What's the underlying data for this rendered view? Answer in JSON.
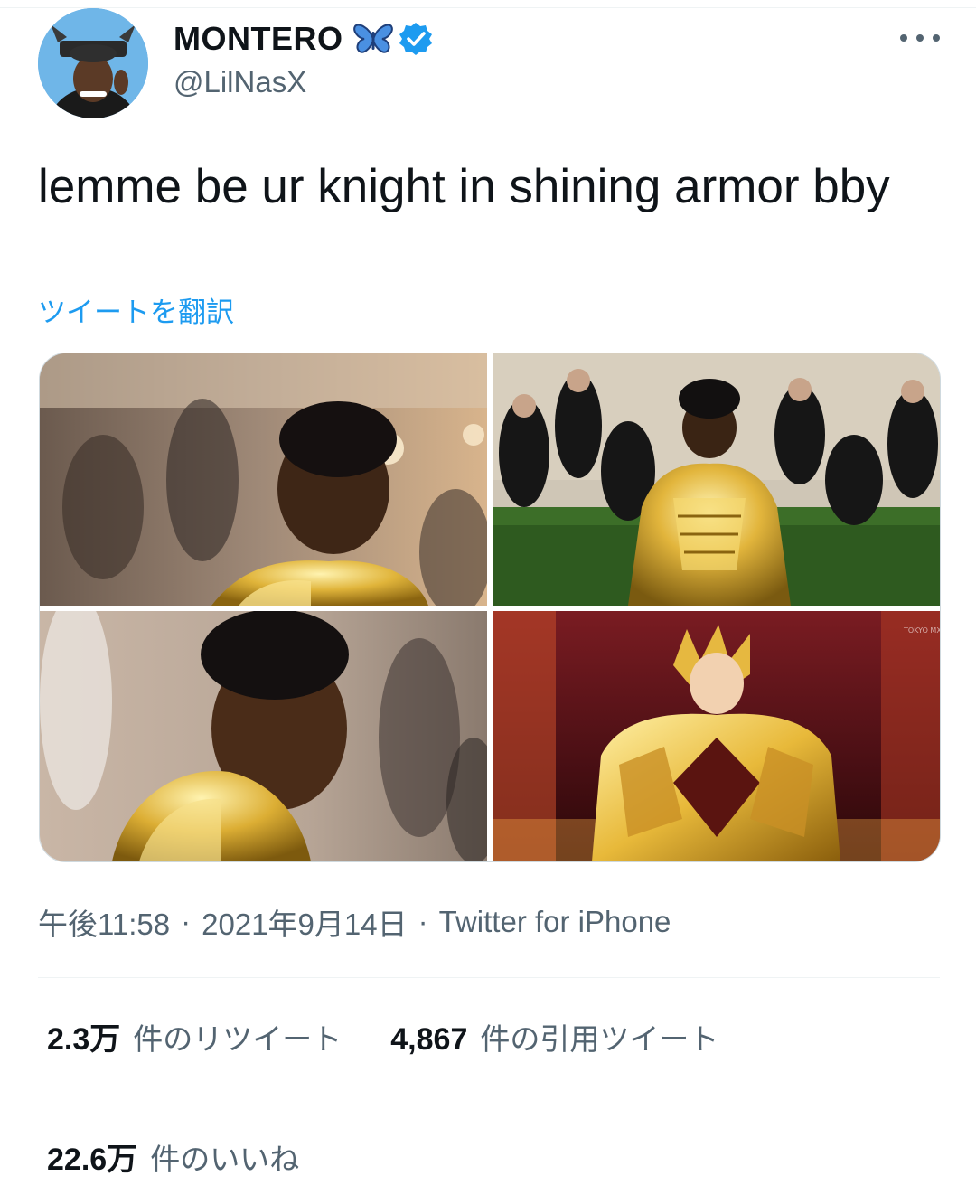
{
  "tweet": {
    "author": {
      "display_name": "MONTERO",
      "handle": "@LilNasX",
      "name_emoji": "butterfly-icon",
      "verified": true,
      "verified_color": "#1d9bf0"
    },
    "text": "lemme be ur knight in shining armor bby",
    "translate_label": "ツイートを翻訳",
    "media": [
      {
        "name": "photo-1"
      },
      {
        "name": "photo-2"
      },
      {
        "name": "photo-3"
      },
      {
        "name": "photo-4",
        "watermark": "TOKYO MX"
      }
    ],
    "time": "午後11:58",
    "date": "2021年9月14日",
    "separator": "·",
    "source": "Twitter for iPhone",
    "stats": {
      "retweets_count": "2.3万",
      "retweets_label": "件のリツイート",
      "quotes_count": "4,867",
      "quotes_label": "件の引用ツイート",
      "likes_count": "22.6万",
      "likes_label": "件のいいね"
    }
  },
  "colors": {
    "accent": "#1d9bf0",
    "text_primary": "#0f1419",
    "text_secondary": "#536471",
    "border": "#cfd9de"
  }
}
